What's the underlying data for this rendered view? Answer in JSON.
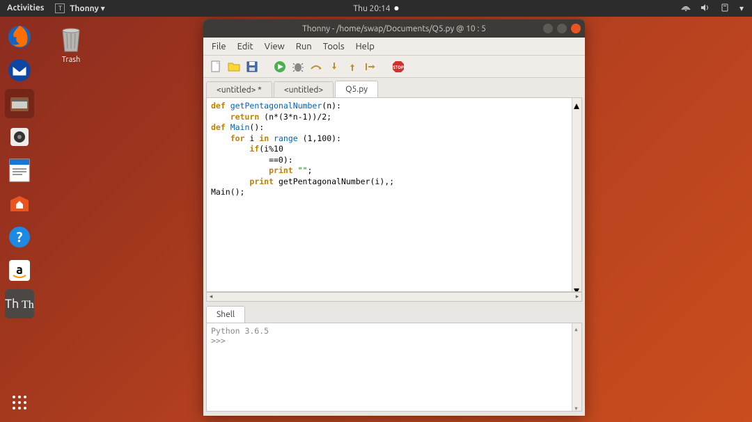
{
  "topbar": {
    "activities": "Activities",
    "app_label": "Thonny",
    "datetime": "Thu 20:14",
    "dropdown_glyph": "▾"
  },
  "desktop": {
    "trash_label": "Trash"
  },
  "window": {
    "title": "Thonny  -  /home/swap/Documents/Q5.py  @  10 : 5"
  },
  "menubar": [
    "File",
    "Edit",
    "View",
    "Run",
    "Tools",
    "Help"
  ],
  "toolbar_icons": [
    "new-file",
    "open-file",
    "save",
    "run",
    "debug",
    "step-over",
    "step-into",
    "step-out",
    "resume",
    "stop"
  ],
  "editor_tabs": [
    {
      "label": "<untitled> *",
      "active": false
    },
    {
      "label": "<untitled>",
      "active": false
    },
    {
      "label": "Q5.py",
      "active": true
    }
  ],
  "code_lines": [
    {
      "t": [
        [
          "kw",
          "def "
        ],
        [
          "fn",
          "getPentagonalNumber"
        ],
        [
          "",
          "(n):"
        ]
      ]
    },
    {
      "t": [
        [
          "",
          "    "
        ],
        [
          "kw",
          "return "
        ],
        [
          "",
          "(n*(3*n-1))/2;"
        ]
      ]
    },
    {
      "t": [
        [
          "",
          ""
        ]
      ]
    },
    {
      "t": [
        [
          "kw",
          "def "
        ],
        [
          "fn",
          "Main"
        ],
        [
          "",
          "():"
        ]
      ]
    },
    {
      "t": [
        [
          "",
          "    "
        ],
        [
          "kw",
          "for "
        ],
        [
          "",
          "i "
        ],
        [
          "kw",
          "in "
        ],
        [
          "fn",
          "range "
        ],
        [
          "",
          "(1,100):"
        ]
      ]
    },
    {
      "t": [
        [
          "",
          "        "
        ],
        [
          "kw",
          "if"
        ],
        [
          "",
          "(i%10"
        ]
      ]
    },
    {
      "t": [
        [
          "",
          "            ==0):"
        ]
      ]
    },
    {
      "t": [
        [
          "",
          "            "
        ],
        [
          "kw",
          "print "
        ],
        [
          "str",
          "\"\""
        ],
        [
          "",
          ";"
        ]
      ]
    },
    {
      "t": [
        [
          "",
          "        "
        ],
        [
          "kw",
          "print "
        ],
        [
          "",
          "getPentagonalNumber(i),;"
        ]
      ]
    },
    {
      "t": [
        [
          "",
          ""
        ]
      ]
    },
    {
      "t": [
        [
          "",
          "Main();"
        ]
      ]
    }
  ],
  "shell": {
    "tab_label": "Shell",
    "version_line": "Python 3.6.5",
    "prompt": ">>>"
  }
}
